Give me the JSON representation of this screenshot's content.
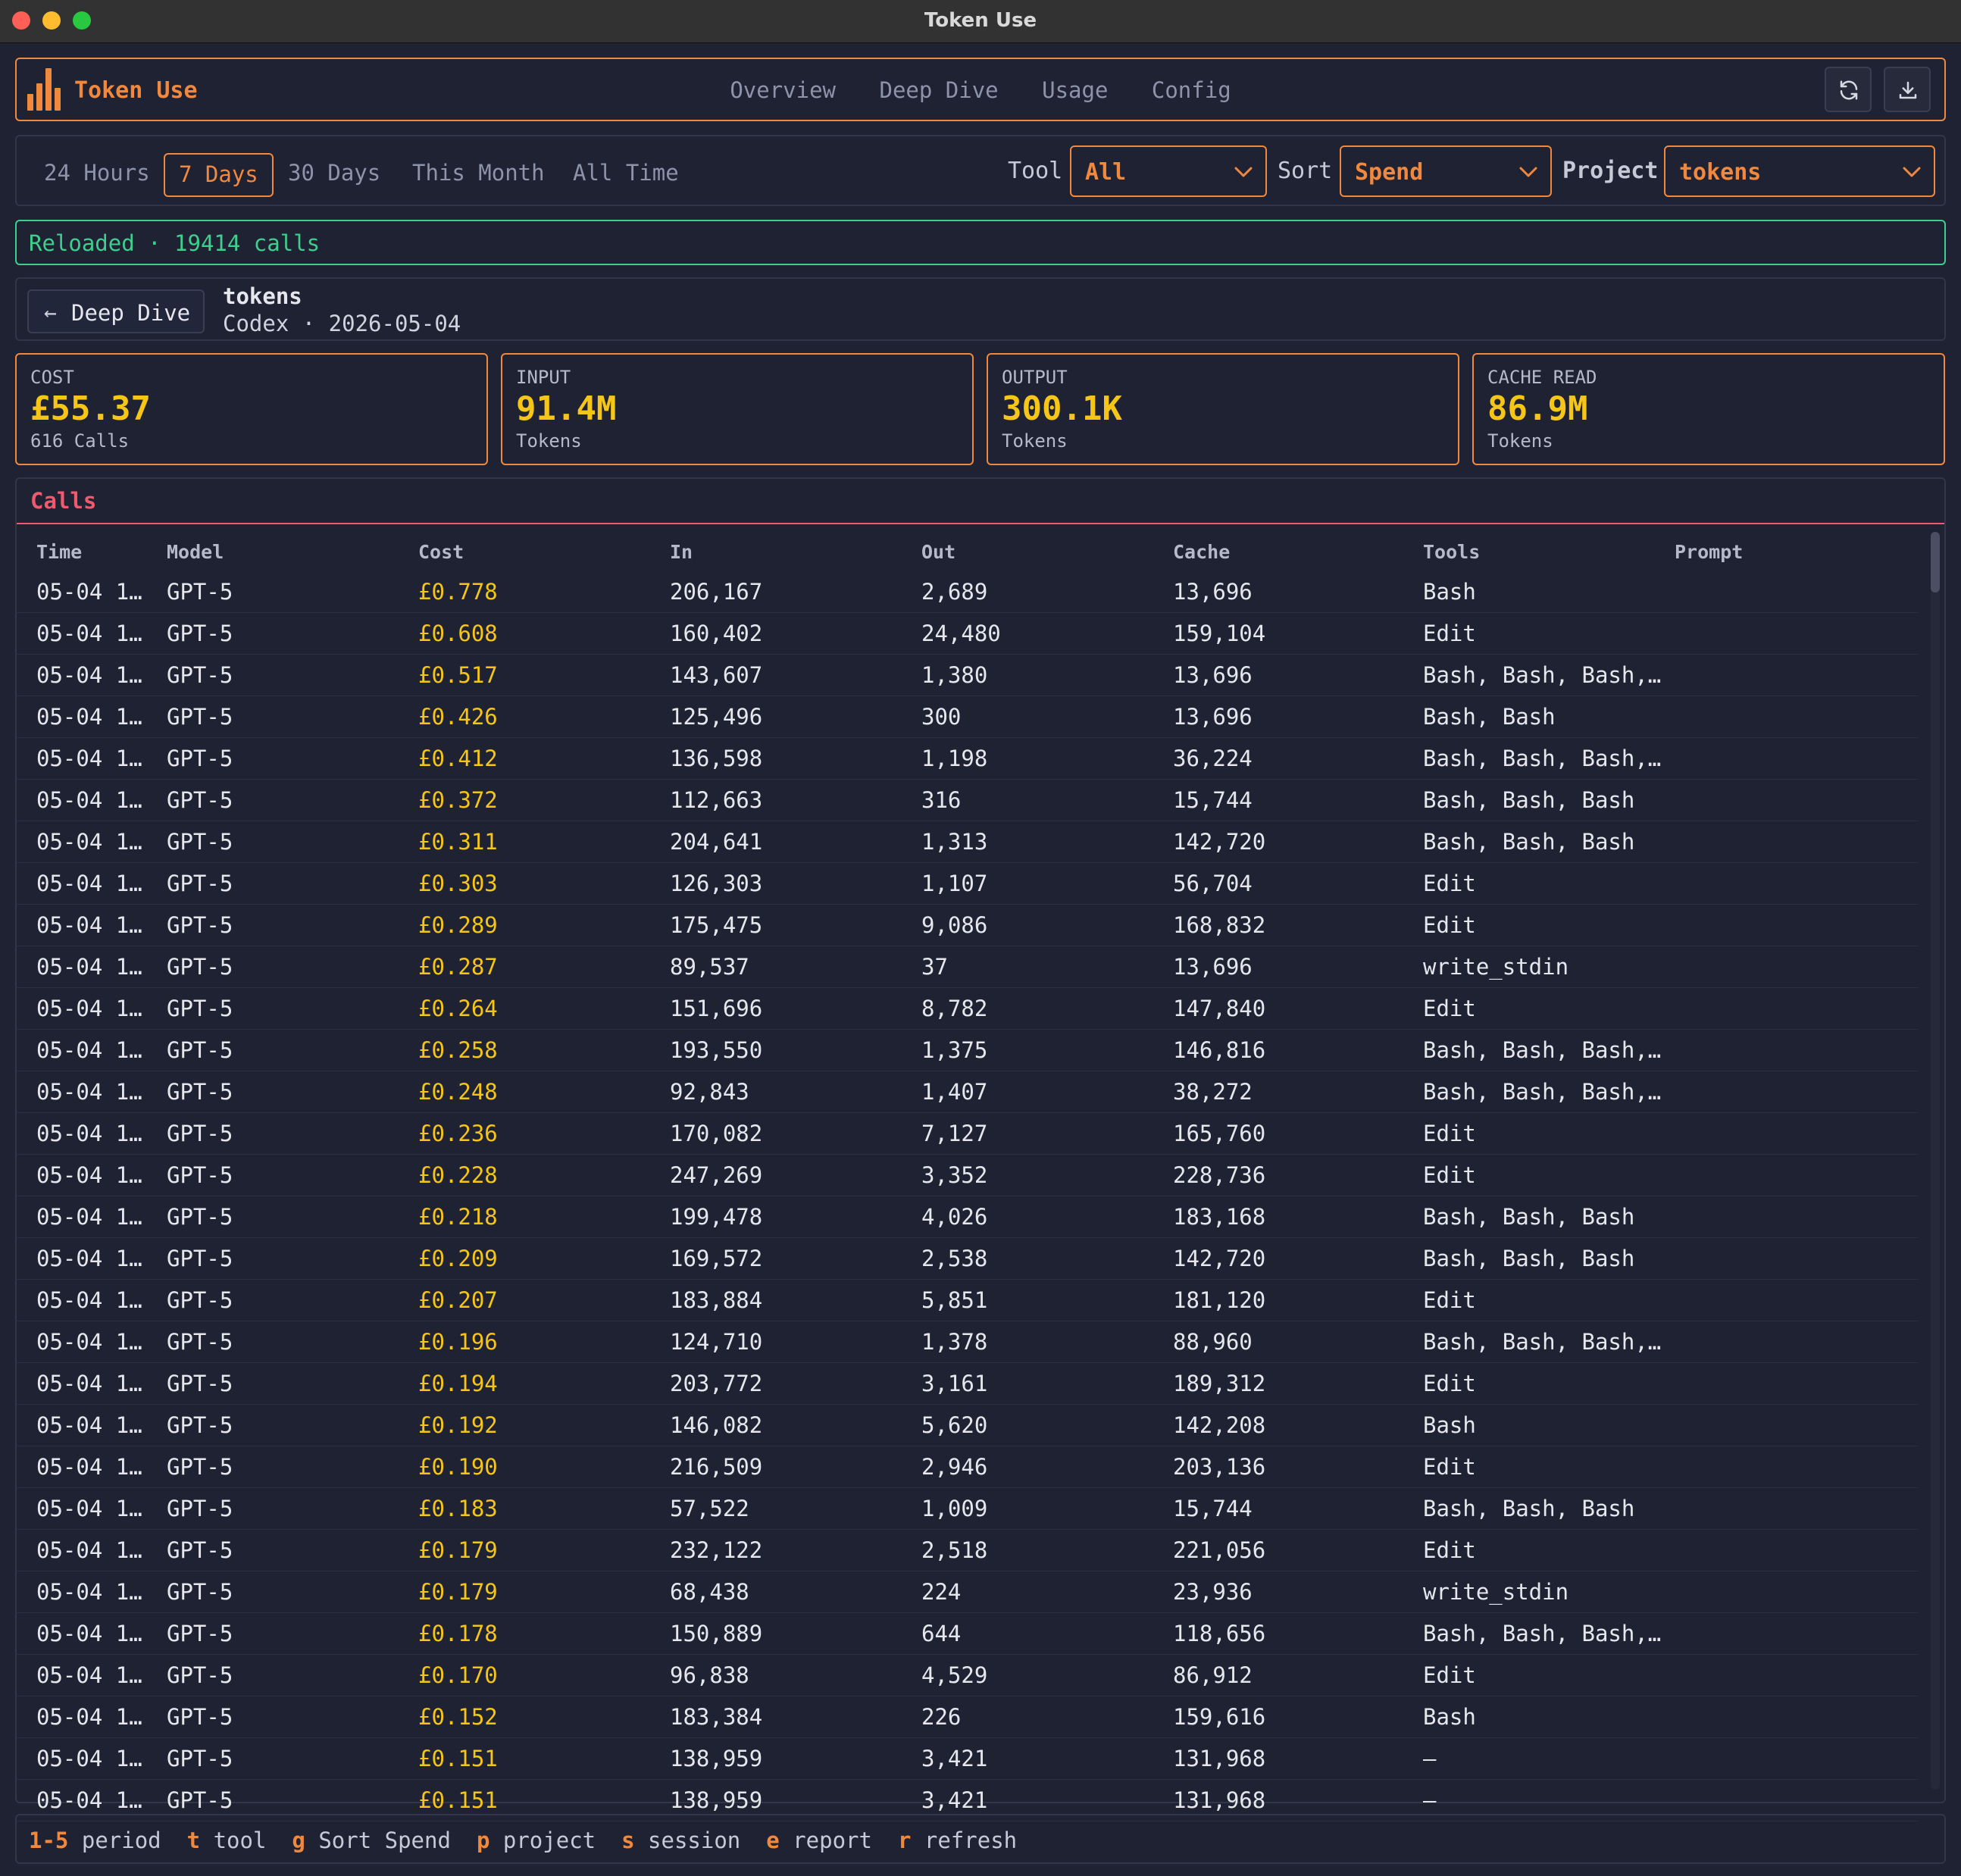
{
  "window": {
    "title": "Token Use"
  },
  "header": {
    "brand": "Token Use",
    "nav": [
      "Overview",
      "Deep Dive",
      "Usage",
      "Config"
    ]
  },
  "filters": {
    "periods": [
      "24 Hours",
      "7 Days",
      "30 Days",
      "This Month",
      "All Time"
    ],
    "active_period": "7 Days",
    "tool_label": "Tool",
    "tool_value": "All",
    "sort_label": "Sort",
    "sort_value": "Spend",
    "project_label": "Project",
    "project_value": "tokens"
  },
  "toast": "Reloaded · 19414 calls",
  "breadcrumb": {
    "back_label": "Deep Dive",
    "title": "tokens",
    "subtitle": "Codex · 2026-05-04"
  },
  "stats": [
    {
      "label": "COST",
      "value": "£55.37",
      "sub": "616 Calls"
    },
    {
      "label": "INPUT",
      "value": "91.4M",
      "sub": "Tokens"
    },
    {
      "label": "OUTPUT",
      "value": "300.1K",
      "sub": "Tokens"
    },
    {
      "label": "CACHE READ",
      "value": "86.9M",
      "sub": "Tokens"
    }
  ],
  "calls": {
    "title": "Calls",
    "columns": [
      "Time",
      "Model",
      "Cost",
      "In",
      "Out",
      "Cache",
      "Tools",
      "Prompt"
    ],
    "rows": [
      [
        "05-04 1…",
        "GPT-5",
        "£0.778",
        "206,167",
        "2,689",
        "13,696",
        "Bash",
        ""
      ],
      [
        "05-04 1…",
        "GPT-5",
        "£0.608",
        "160,402",
        "24,480",
        "159,104",
        "Edit",
        ""
      ],
      [
        "05-04 1…",
        "GPT-5",
        "£0.517",
        "143,607",
        "1,380",
        "13,696",
        "Bash, Bash, Bash,…",
        ""
      ],
      [
        "05-04 1…",
        "GPT-5",
        "£0.426",
        "125,496",
        "300",
        "13,696",
        "Bash, Bash",
        ""
      ],
      [
        "05-04 1…",
        "GPT-5",
        "£0.412",
        "136,598",
        "1,198",
        "36,224",
        "Bash, Bash, Bash,…",
        ""
      ],
      [
        "05-04 1…",
        "GPT-5",
        "£0.372",
        "112,663",
        "316",
        "15,744",
        "Bash, Bash, Bash",
        ""
      ],
      [
        "05-04 1…",
        "GPT-5",
        "£0.311",
        "204,641",
        "1,313",
        "142,720",
        "Bash, Bash, Bash",
        ""
      ],
      [
        "05-04 1…",
        "GPT-5",
        "£0.303",
        "126,303",
        "1,107",
        "56,704",
        "Edit",
        ""
      ],
      [
        "05-04 1…",
        "GPT-5",
        "£0.289",
        "175,475",
        "9,086",
        "168,832",
        "Edit",
        ""
      ],
      [
        "05-04 1…",
        "GPT-5",
        "£0.287",
        "89,537",
        "37",
        "13,696",
        "write_stdin",
        ""
      ],
      [
        "05-04 1…",
        "GPT-5",
        "£0.264",
        "151,696",
        "8,782",
        "147,840",
        "Edit",
        ""
      ],
      [
        "05-04 1…",
        "GPT-5",
        "£0.258",
        "193,550",
        "1,375",
        "146,816",
        "Bash, Bash, Bash,…",
        ""
      ],
      [
        "05-04 1…",
        "GPT-5",
        "£0.248",
        "92,843",
        "1,407",
        "38,272",
        "Bash, Bash, Bash,…",
        ""
      ],
      [
        "05-04 1…",
        "GPT-5",
        "£0.236",
        "170,082",
        "7,127",
        "165,760",
        "Edit",
        ""
      ],
      [
        "05-04 1…",
        "GPT-5",
        "£0.228",
        "247,269",
        "3,352",
        "228,736",
        "Edit",
        ""
      ],
      [
        "05-04 1…",
        "GPT-5",
        "£0.218",
        "199,478",
        "4,026",
        "183,168",
        "Bash, Bash, Bash",
        ""
      ],
      [
        "05-04 1…",
        "GPT-5",
        "£0.209",
        "169,572",
        "2,538",
        "142,720",
        "Bash, Bash, Bash",
        ""
      ],
      [
        "05-04 1…",
        "GPT-5",
        "£0.207",
        "183,884",
        "5,851",
        "181,120",
        "Edit",
        ""
      ],
      [
        "05-04 1…",
        "GPT-5",
        "£0.196",
        "124,710",
        "1,378",
        "88,960",
        "Bash, Bash, Bash,…",
        ""
      ],
      [
        "05-04 1…",
        "GPT-5",
        "£0.194",
        "203,772",
        "3,161",
        "189,312",
        "Edit",
        ""
      ],
      [
        "05-04 1…",
        "GPT-5",
        "£0.192",
        "146,082",
        "5,620",
        "142,208",
        "Bash",
        ""
      ],
      [
        "05-04 1…",
        "GPT-5",
        "£0.190",
        "216,509",
        "2,946",
        "203,136",
        "Edit",
        ""
      ],
      [
        "05-04 1…",
        "GPT-5",
        "£0.183",
        "57,522",
        "1,009",
        "15,744",
        "Bash, Bash, Bash",
        ""
      ],
      [
        "05-04 1…",
        "GPT-5",
        "£0.179",
        "232,122",
        "2,518",
        "221,056",
        "Edit",
        ""
      ],
      [
        "05-04 1…",
        "GPT-5",
        "£0.179",
        "68,438",
        "224",
        "23,936",
        "write_stdin",
        ""
      ],
      [
        "05-04 1…",
        "GPT-5",
        "£0.178",
        "150,889",
        "644",
        "118,656",
        "Bash, Bash, Bash,…",
        ""
      ],
      [
        "05-04 1…",
        "GPT-5",
        "£0.170",
        "96,838",
        "4,529",
        "86,912",
        "Edit",
        ""
      ],
      [
        "05-04 1…",
        "GPT-5",
        "£0.152",
        "183,384",
        "226",
        "159,616",
        "Bash",
        ""
      ],
      [
        "05-04 1…",
        "GPT-5",
        "£0.151",
        "138,959",
        "3,421",
        "131,968",
        "–",
        ""
      ],
      [
        "05-04 1…",
        "GPT-5",
        "£0.151",
        "138,959",
        "3,421",
        "131,968",
        "–",
        ""
      ]
    ]
  },
  "footer": {
    "shortcuts": [
      {
        "key": "1-5",
        "desc": "period"
      },
      {
        "key": "t",
        "desc": "tool"
      },
      {
        "key": "g",
        "desc": "Sort Spend"
      },
      {
        "key": "p",
        "desc": "project"
      },
      {
        "key": "s",
        "desc": "session"
      },
      {
        "key": "e",
        "desc": "report"
      },
      {
        "key": "r",
        "desc": "refresh"
      }
    ]
  },
  "icons": {
    "logo": "bar-chart-icon",
    "refresh": "refresh-icon",
    "download": "download-icon",
    "back": "arrow-left-icon",
    "dropdown": "chevron-down-icon"
  },
  "colors": {
    "accent": "#f0883e",
    "value": "#f5c518",
    "success": "#3ecf8e",
    "section": "#ef5a6f"
  }
}
